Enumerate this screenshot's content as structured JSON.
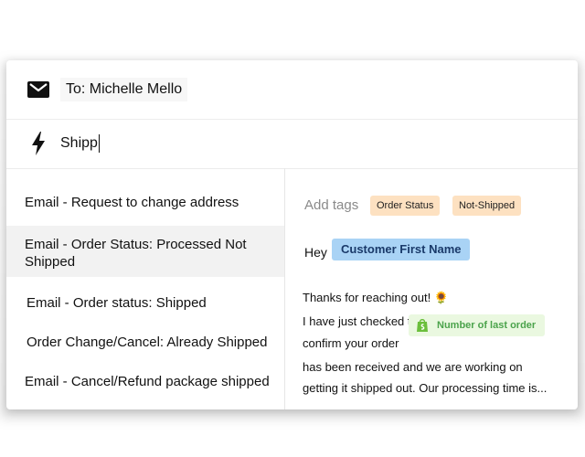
{
  "compose": {
    "to_label": "To: Michelle Mello",
    "search_value": "Shipp"
  },
  "templates": [
    {
      "label": "Email - Request to change address"
    },
    {
      "label_line1": "Email - Order Status: Processed Not",
      "label_line2": "Shipped",
      "selected": true
    },
    {
      "label": "Email - Order status: Shipped"
    },
    {
      "label": "Order Change/Cancel: Already Shipped"
    },
    {
      "label": "Email - Cancel/Refund package shipped"
    }
  ],
  "preview": {
    "add_tags_label": "Add tags",
    "tags": [
      "Order Status",
      "Not-Shipped"
    ],
    "greeting": "Hey",
    "customer_var": "Customer First Name",
    "line1": "Thanks for reaching out! 🌻",
    "line2": "I have just checked this for you and can",
    "line3": "confirm your order",
    "order_var": "Number of last order",
    "line4": "has been received and we are working on",
    "line5": "getting it shipped out. Our processing time is..."
  },
  "colors": {
    "tag_bg": "#fde1c1",
    "customer_var_bg": "#a9d3f5",
    "order_var_bg": "#eaf8e0",
    "order_var_text": "#4ba34b",
    "selected_row_bg": "#f2f2f2"
  },
  "icons": [
    "mail-icon",
    "lightning-icon",
    "shopify-icon"
  ]
}
